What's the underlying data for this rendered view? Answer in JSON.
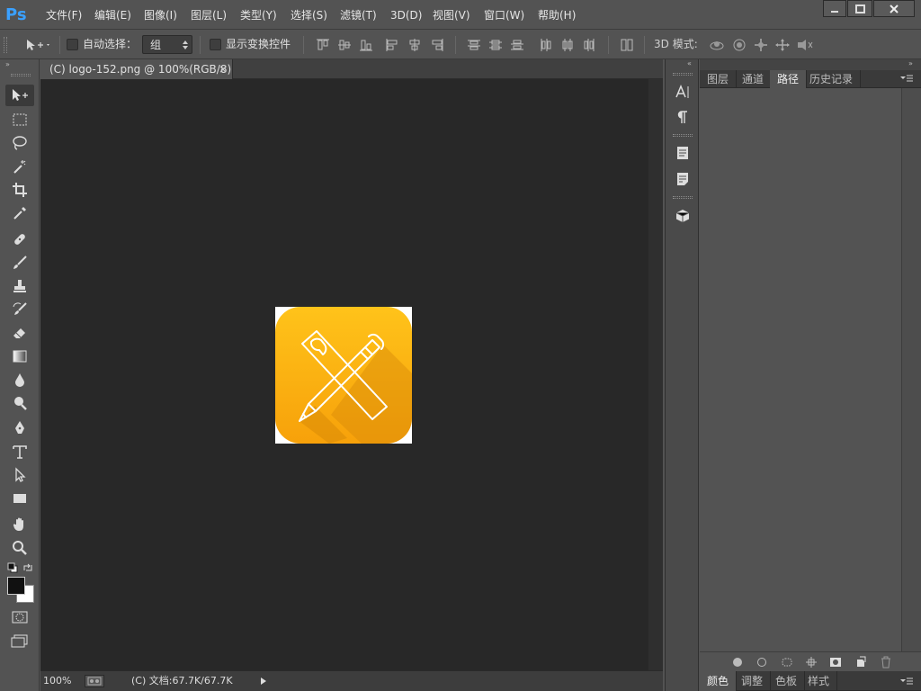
{
  "app": {
    "logo": "Ps"
  },
  "menu": [
    "文件(F)",
    "编辑(E)",
    "图像(I)",
    "图层(L)",
    "类型(Y)",
    "选择(S)",
    "滤镜(T)",
    "3D(D)",
    "视图(V)",
    "窗口(W)",
    "帮助(H)"
  ],
  "window_buttons": {
    "minimize_icon": "minimize-icon",
    "maximize_icon": "maximize-icon",
    "close_icon": "close-icon"
  },
  "options": {
    "auto_select_label": "自动选择：",
    "auto_select_value": "组",
    "show_transform_label": "显示变换控件",
    "mode_3d_label": "3D 模式:"
  },
  "document": {
    "tab_title": "(C) logo-152.png @ 100%(RGB/8)",
    "tab_close": "×",
    "zoom": "100%",
    "doc_info": "(C) 文档:67.7K/67.7K"
  },
  "panels": {
    "top_tabs": [
      "图层",
      "通道",
      "路径",
      "历史记录"
    ],
    "top_active": "路径",
    "bottom_tabs": [
      "颜色",
      "调整",
      "色板",
      "样式"
    ],
    "bottom_active": "颜色"
  },
  "colors": {
    "accent": "#3aa0ff",
    "logo_yellow": "#ffba0e",
    "logo_orange": "#f7a10a",
    "canvas_bg": "#282828",
    "ui_bg": "#535353"
  }
}
